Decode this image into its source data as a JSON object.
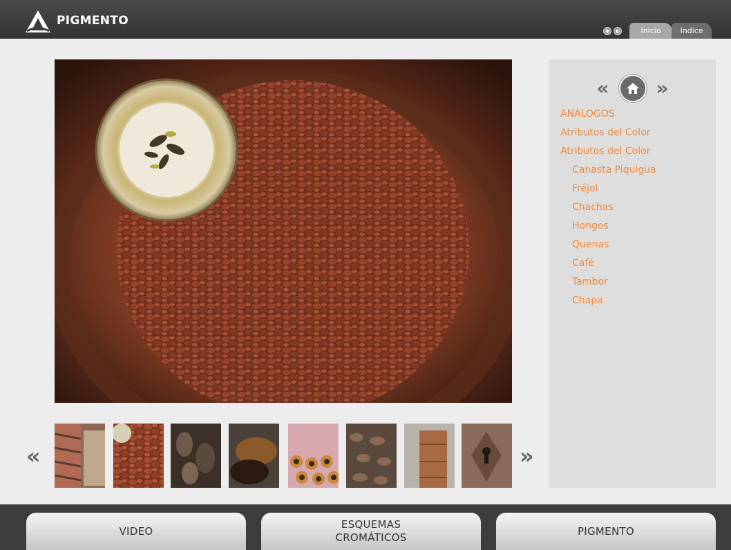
{
  "header": {
    "brand": "PIGMENTO",
    "logo_icon": "triangle-logo-icon"
  },
  "tabs": [
    {
      "label": "Inicio"
    },
    {
      "label": "Indice"
    }
  ],
  "top_icons": [
    "camera-icon",
    "sound-icon"
  ],
  "sidebar": {
    "prev_icon": "double-chevron-left-icon",
    "home_icon": "home-icon",
    "next_icon": "double-chevron-right-icon",
    "items": [
      {
        "label": "ANÁLOGOS"
      },
      {
        "label": "Atributos del Color"
      },
      {
        "label": "Atributos del Color"
      },
      {
        "label": "Canasta Piquigua"
      },
      {
        "label": "Fréjol"
      },
      {
        "label": "Chachas"
      },
      {
        "label": "Hongos"
      },
      {
        "label": "Quenas"
      },
      {
        "label": "Café"
      },
      {
        "label": "Tambor"
      },
      {
        "label": "Chapa"
      }
    ]
  },
  "thumbnails": [
    {
      "name": "woven-basket"
    },
    {
      "name": "red-beans"
    },
    {
      "name": "dried-pods"
    },
    {
      "name": "mushrooms"
    },
    {
      "name": "quenas-flutes"
    },
    {
      "name": "cacao-beans"
    },
    {
      "name": "drum"
    },
    {
      "name": "keyhole-plate"
    }
  ],
  "strip_nav": {
    "prev": "«",
    "next": "»"
  },
  "bottom_buttons": {
    "video": "VIDEO",
    "esquemas_line1": "ESQUEMAS",
    "esquemas_line2": "CROMÁTICOS",
    "pigmento": "PIGMENTO"
  },
  "colors": {
    "accent": "#f08a3c",
    "header": "#3a3a3a",
    "panel": "#dedede"
  }
}
